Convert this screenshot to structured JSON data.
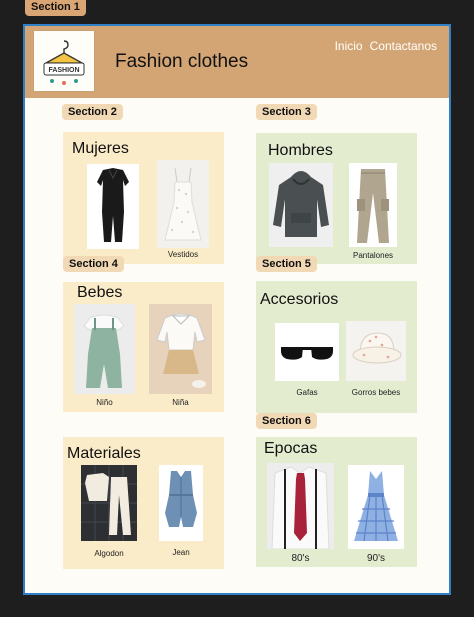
{
  "sections": {
    "s1": "Section 1",
    "s2": "Section 2",
    "s3": "Section 3",
    "s4": "Section 4",
    "s5": "Section 5",
    "s6": "Section 6"
  },
  "header": {
    "logo_text": "FASHION",
    "brand": "Fashion clothes",
    "nav": [
      "Inicio",
      "Contactanos"
    ]
  },
  "cards": {
    "mujeres": {
      "title": "Mujeres",
      "items": [
        "",
        "Vestidos"
      ]
    },
    "hombres": {
      "title": "Hombres",
      "items": [
        "",
        "Pantalones"
      ]
    },
    "bebes": {
      "title": "Bebes",
      "items": [
        "Niño",
        "Niña"
      ]
    },
    "accesorios": {
      "title": "Accesorios",
      "items": [
        "Gafas",
        "Gorros bebes"
      ]
    },
    "materiales": {
      "title": "Materiales",
      "items": [
        "Algodon",
        "Jean"
      ]
    },
    "epocas": {
      "title": "Epocas",
      "items": [
        "80's",
        "90's"
      ]
    }
  },
  "colors": {
    "header": "#d4a574",
    "beige_card": "#fbecc9",
    "green_card": "#e4ecd0",
    "frame_border": "#2f80c8"
  }
}
